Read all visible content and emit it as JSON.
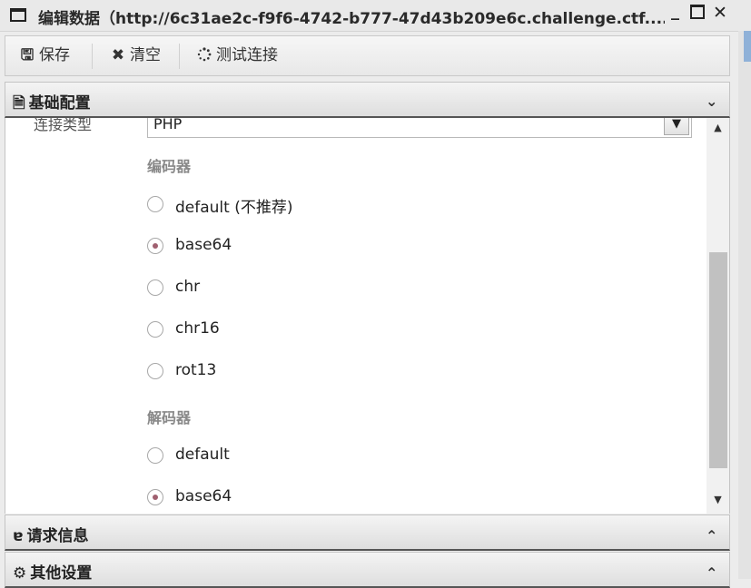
{
  "window": {
    "title": "编辑数据（http://6c31ae2c-f9f6-4742-b777-47d43b209e6c.challenge.ctf....",
    "minimize": "_",
    "close": "✕"
  },
  "toolbar": {
    "save_label": "保存",
    "clear_label": "清空",
    "test_label": "测试连接"
  },
  "sections": {
    "basic": {
      "label": "基础配置",
      "icon": "file-icon"
    },
    "request": {
      "label": "请求信息",
      "icon": "edge-icon"
    },
    "other": {
      "label": "其他设置",
      "icon": "gears-icon"
    }
  },
  "basic": {
    "conn_type_label": "连接类型",
    "conn_type_value": "PHP",
    "encoder_title": "编码器",
    "encoders": [
      {
        "label": "default (不推荐)",
        "checked": false
      },
      {
        "label": "base64",
        "checked": true
      },
      {
        "label": "chr",
        "checked": false
      },
      {
        "label": "chr16",
        "checked": false
      },
      {
        "label": "rot13",
        "checked": false
      }
    ],
    "decoder_title": "解码器",
    "decoders": [
      {
        "label": "default",
        "checked": false
      },
      {
        "label": "base64",
        "checked": true
      }
    ]
  },
  "colors": {
    "accent": "#a06070",
    "header_border": "#555555"
  }
}
